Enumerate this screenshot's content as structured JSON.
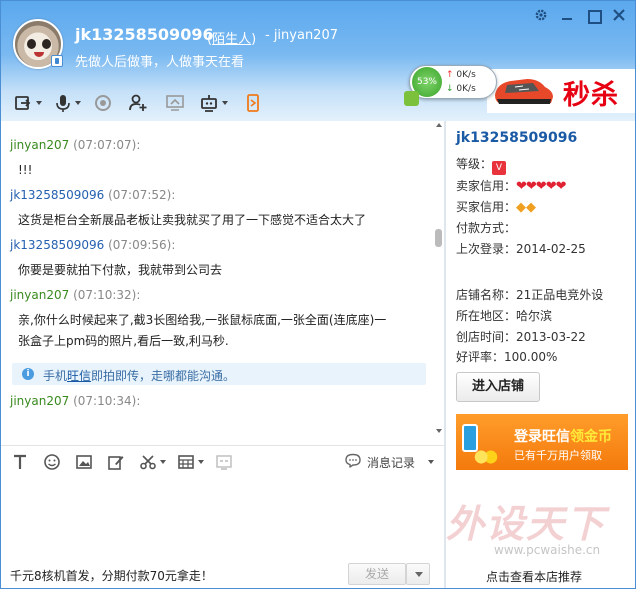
{
  "header": {
    "user_name": "jk13258509096",
    "stranger_prefix": "(",
    "stranger_link": "陌生人",
    "stranger_suffix": ")",
    "peer_name": "- jinyan207",
    "signature": "先做人后做事，人做事天在看",
    "window_controls": [
      "gear-icon",
      "minimize-icon",
      "maximize-icon",
      "close-icon"
    ]
  },
  "speed_widget": {
    "percent": "53%",
    "upload": "0K/s",
    "download": "0K/s"
  },
  "ad_banner": {
    "text": "秒杀"
  },
  "toolbar": {
    "icons": [
      "transfer-file-icon",
      "voice-icon",
      "video-icon",
      "add-contact-icon",
      "screen-share-icon",
      "remote-assist-icon",
      "mobile-icon"
    ]
  },
  "chat": {
    "messages": [
      {
        "sender": "jinyan207",
        "time": "(07:07:07):",
        "text": "!!!",
        "role": "me"
      },
      {
        "sender": "jk13258509096",
        "time": "(07:07:52):",
        "text": "这货是柜台全新展品老板让卖我就买了用了一下感觉不适合太大了",
        "role": "other"
      },
      {
        "sender": "jk13258509096",
        "time": "(07:09:56):",
        "text": "你要是要就拍下付款，我就带到公司去",
        "role": "other"
      },
      {
        "sender": "jinyan207",
        "time": "(07:10:32):",
        "text": "亲,你什么时候起来了,截3长图给我,一张鼠标底面,一张全面(连底座)一",
        "text2": "张盒子上pm码的照片,看后一致,利马秒.",
        "role": "me"
      },
      {
        "sender": "jinyan207",
        "time": "(07:10:34):",
        "text": "",
        "role": "me"
      }
    ],
    "notice": {
      "prefix": "手机",
      "highlight": "旺信",
      "suffix": "即拍即传，走哪都能沟通。"
    }
  },
  "input_toolbar": {
    "icons": [
      "font-icon",
      "emoji-icon",
      "image-icon",
      "edit-icon",
      "screenshot-icon",
      "calculator-icon",
      "shake-icon"
    ],
    "history_label": "消息记录"
  },
  "bottom": {
    "promo_text": "千元8核机首发，分期付款70元拿走！",
    "send_label": "发送"
  },
  "seller": {
    "name": "jk13258509096",
    "level_label": "等级：",
    "level_badge": "V",
    "seller_credit_label": "卖家信用：",
    "seller_credit_icons": "❤❤❤❤❤",
    "buyer_credit_label": "买家信用：",
    "buyer_credit_icons": "◆◆",
    "payment_label": "付款方式：",
    "last_login_label": "上次登录：",
    "last_login": "2014-02-25",
    "shop_name_label": "店铺名称：",
    "shop_name": "21正品电竞外设",
    "location_label": "所在地区：",
    "location": "哈尔滨",
    "created_label": "创店时间：",
    "created": "2013-03-22",
    "rating_label": "好评率：",
    "rating": "100.00%",
    "enter_shop_label": "进入店铺",
    "wangxin_ad": {
      "line1_a": "登录旺信",
      "line1_b": "领金币",
      "line2": "已有千万用户领取"
    },
    "watermark_logo": "外设天下",
    "watermark_url": "www.pcwaishe.cn",
    "recommend_link": "点击查看本店推荐"
  },
  "colors": {
    "header_top": "#5aa8ee",
    "link_blue": "#1a5aa5",
    "me_green": "#3a8a1f",
    "ad_red": "#e60012",
    "ad_orange": "#f47a0d"
  }
}
